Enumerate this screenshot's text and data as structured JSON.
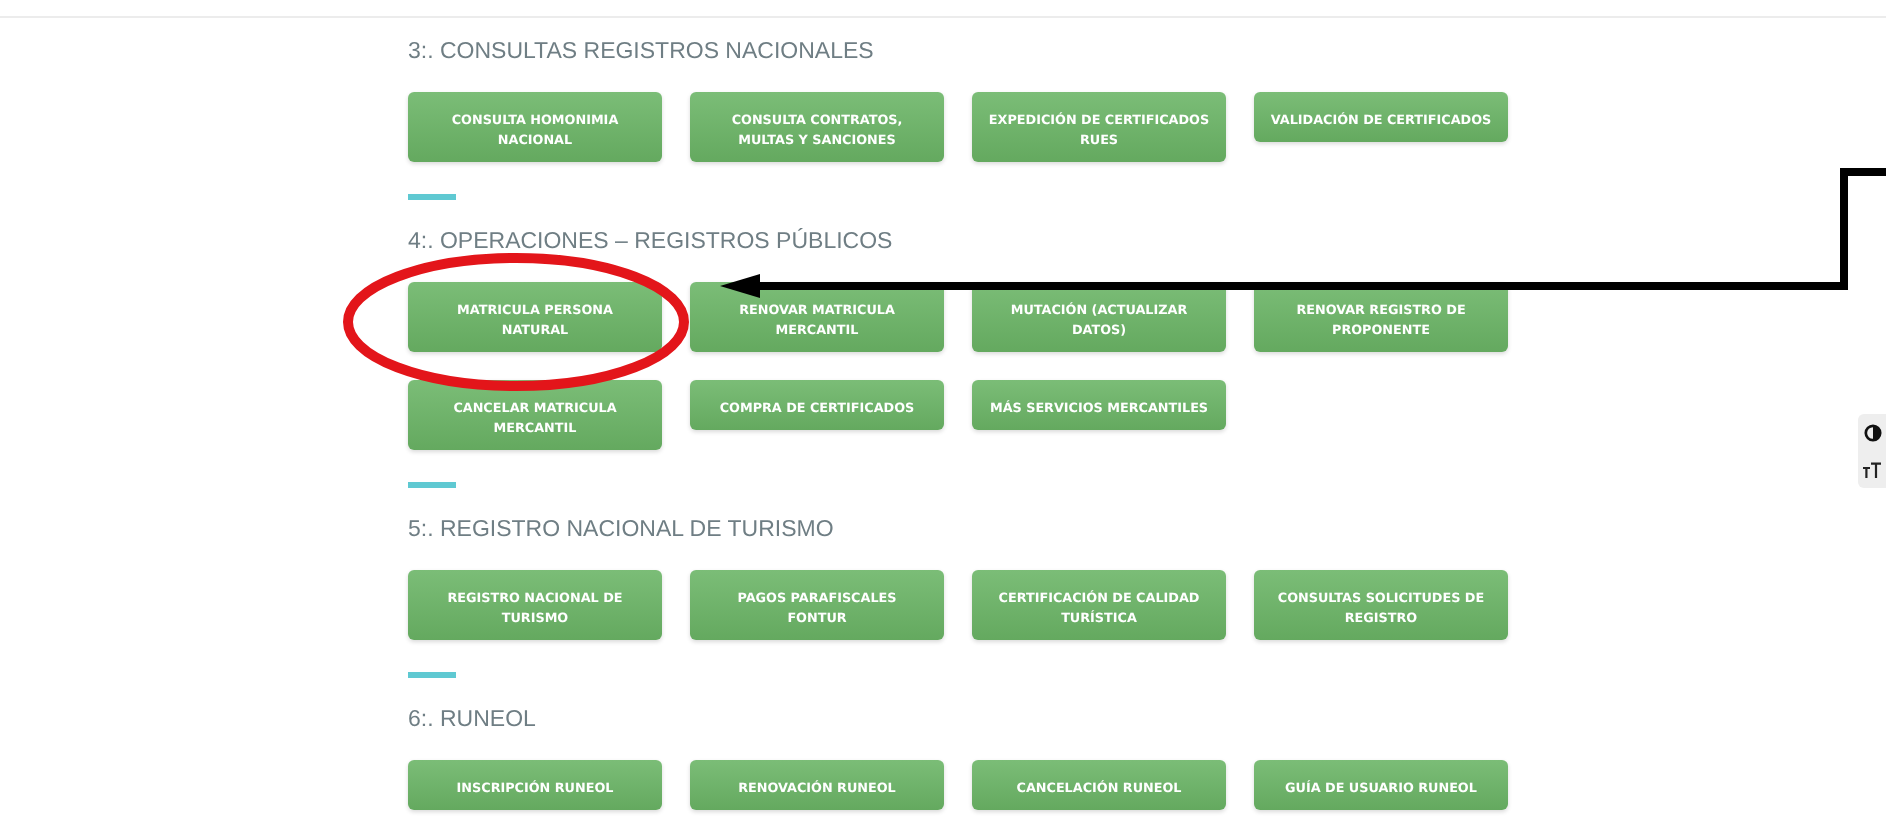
{
  "sections": [
    {
      "title": "3:. CONSULTAS REGISTROS NACIONALES",
      "buttons": [
        "CONSULTA HOMONIMIA NACIONAL",
        "CONSULTA CONTRATOS, MULTAS Y SANCIONES",
        "EXPEDICIÓN DE CERTIFICADOS RUES",
        "VALIDACIÓN DE CERTIFICADOS"
      ]
    },
    {
      "title": "4:. OPERACIONES – REGISTROS PÚBLICOS",
      "buttons": [
        "MATRICULA PERSONA NATURAL",
        "RENOVAR MATRICULA MERCANTIL",
        "MUTACIÓN (ACTUALIZAR DATOS)",
        "RENOVAR REGISTRO DE PROPONENTE",
        "CANCELAR MATRICULA MERCANTIL",
        "COMPRA DE CERTIFICADOS",
        "MÁS SERVICIOS MERCANTILES"
      ]
    },
    {
      "title": "5:. REGISTRO NACIONAL DE TURISMO",
      "buttons": [
        "REGISTRO NACIONAL DE TURISMO",
        "PAGOS PARAFISCALES FONTUR",
        "CERTIFICACIÓN DE CALIDAD TURÍSTICA",
        "CONSULTAS SOLICITUDES DE REGISTRO"
      ]
    },
    {
      "title": "6:. RUNEOL",
      "buttons": [
        "INSCRIPCIÓN RUNEOL",
        "RENOVACIÓN RUNEOL",
        "CANCELACIÓN RUNEOL",
        "GUÍA DE USUARIO RUNEOL"
      ]
    }
  ]
}
